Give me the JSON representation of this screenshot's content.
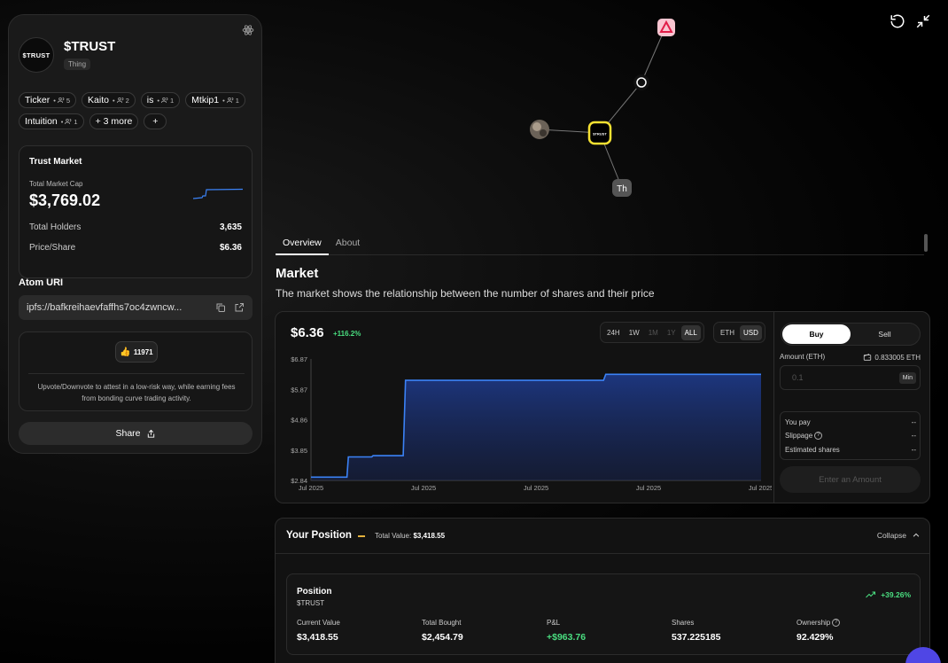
{
  "atom": {
    "logo_text": "$TRUST",
    "title": "$TRUST",
    "type": "Thing"
  },
  "tags": [
    {
      "label": "Ticker",
      "count": "5"
    },
    {
      "label": "Kaito",
      "count": "2"
    },
    {
      "label": "is",
      "count": "1"
    },
    {
      "label": "Mtkip1",
      "count": "1"
    },
    {
      "label": "Intuition",
      "count": "1"
    }
  ],
  "tags_more": "+ 3 more",
  "tags_add": "+",
  "trust_market": {
    "title": "Trust Market",
    "cap_label": "Total Market Cap",
    "cap_value": "$3,769.02",
    "holders_label": "Total Holders",
    "holders_value": "3,635",
    "price_label": "Price/Share",
    "price_value": "$6.36"
  },
  "uri": {
    "label": "Atom URI",
    "value": "ipfs://bafkreihaevfaffhs7oc4zwncw..."
  },
  "vote": {
    "emoji": "👍",
    "count": "11971",
    "description": "Upvote/Downvote to attest in a low-risk way, while earning fees from bonding curve trading activity."
  },
  "share_label": "Share",
  "graph": {
    "center_label": "$TRUST",
    "th_label": "Th"
  },
  "tabs": [
    {
      "label": "Overview"
    },
    {
      "label": "About"
    }
  ],
  "market": {
    "heading": "Market",
    "subtitle": "The market shows the relationship between the number of shares and their price"
  },
  "chart_header": {
    "price": "$6.36",
    "change": "+116.2%",
    "ranges": [
      "24H",
      "1W",
      "1M",
      "1Y",
      "ALL"
    ],
    "units": [
      "ETH",
      "USD"
    ]
  },
  "chart_data": {
    "type": "area",
    "title": "",
    "xlabel": "",
    "ylabel": "",
    "y_tick_labels": [
      "$6.87",
      "$5.87",
      "$4.86",
      "$3.85",
      "$2.84"
    ],
    "x_tick_labels": [
      "Jul 2025",
      "Jul 2025",
      "Jul 2025",
      "Jul 2025",
      "Jul 2025"
    ],
    "ylim": [
      2.84,
      6.87
    ],
    "grid": false,
    "color": "#3b82f6",
    "x": [
      0,
      0.08,
      0.083,
      0.135,
      0.138,
      0.205,
      0.21,
      0.65,
      0.655,
      1.0
    ],
    "y": [
      2.95,
      2.95,
      3.62,
      3.62,
      3.66,
      3.66,
      6.16,
      6.16,
      6.36,
      6.36
    ]
  },
  "trade": {
    "buy_label": "Buy",
    "sell_label": "Sell",
    "amount_label": "Amount (ETH)",
    "balance": "0.833005 ETH",
    "amount_placeholder": "0.1",
    "min_label": "Min",
    "you_pay_label": "You pay",
    "you_pay_value": "--",
    "slippage_label": "Slippage",
    "slippage_value": "--",
    "est_shares_label": "Estimated shares",
    "est_shares_value": "--",
    "enter_label": "Enter an Amount"
  },
  "position": {
    "title": "Your Position",
    "total_label": "Total Value:",
    "total_value": "$3,418.55",
    "collapse_label": "Collapse",
    "card_title": "Position",
    "card_sub": "$TRUST",
    "pct": "+39.26%",
    "stats": [
      {
        "label": "Current Value",
        "value": "$3,418.55"
      },
      {
        "label": "Total Bought",
        "value": "$2,454.79"
      },
      {
        "label": "P&L",
        "value": "+$963.76"
      },
      {
        "label": "Shares",
        "value": "537.225185"
      },
      {
        "label": "Ownership",
        "value": "92.429%"
      }
    ]
  },
  "colors": {
    "accent_blue": "#3b82f6",
    "positive_green": "#4ade80",
    "node_highlight": "#f5e132"
  }
}
